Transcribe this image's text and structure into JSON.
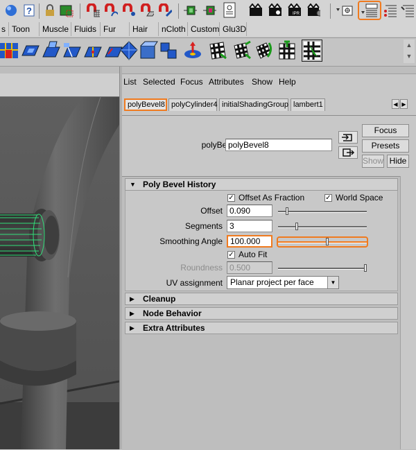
{
  "status_line": {
    "icons": [
      "globe-icon",
      "help-icon",
      "lock-icon",
      "render-region-icon",
      "magnet-grid-icon",
      "magnet-curve-icon",
      "magnet-point-icon",
      "magnet-plane-icon",
      "magnet-live-icon",
      "history-icon",
      "construction-history-icon",
      "render-view-icon",
      "render-icon",
      "ipr-render-icon",
      "render-settings-icon",
      "input-ops-icon",
      "channel-box-icon",
      "attribute-editor-icon",
      "tool-settings-icon"
    ]
  },
  "shelf": {
    "tabs": [
      "s",
      "Toon",
      "Muscle",
      "Fluids",
      "Fur",
      "Hair",
      "nCloth",
      "Custom",
      "Glu3D"
    ],
    "tools": [
      "bevel-tool",
      "extrude-tool",
      "split-tool",
      "append-tool",
      "wedge-tool",
      "smooth-tool",
      "subdivide-tool",
      "plane-tool",
      "sculpt-tool",
      "checker-move-tool",
      "checker-scale-tool",
      "checker-rotate-tool",
      "checker-uv-tool",
      "checker-select-tool"
    ]
  },
  "menubar": [
    "List",
    "Selected",
    "Focus",
    "Attributes",
    "Show",
    "Help"
  ],
  "node_tabs": [
    "polyBevel8",
    "polyCylinder4",
    "initialShadingGroup",
    "lambert1"
  ],
  "node_header": {
    "type_label": "polyBevel:",
    "name_value": "polyBevel8",
    "buttons": {
      "focus": "Focus",
      "presets": "Presets",
      "show": "Show",
      "hide": "Hide"
    }
  },
  "sections": {
    "history_title": "Poly Bevel History",
    "offset_as_fraction": "Offset As Fraction",
    "world_space": "World Space",
    "offset_label": "Offset",
    "offset_value": "0.090",
    "segments_label": "Segments",
    "segments_value": "3",
    "smoothing_label": "Smoothing Angle",
    "smoothing_value": "100.000",
    "auto_fit": "Auto Fit",
    "roundness_label": "Roundness",
    "roundness_value": "0.500",
    "uv_label": "UV assignment",
    "uv_value": "Planar project per face",
    "collapsed": [
      "Cleanup",
      "Node Behavior",
      "Extra Attributes"
    ]
  },
  "sliders": {
    "offset_level": 0.09,
    "segments_level": 0.2,
    "smoothing_level": 0.56,
    "roundness_level": 1.0
  }
}
